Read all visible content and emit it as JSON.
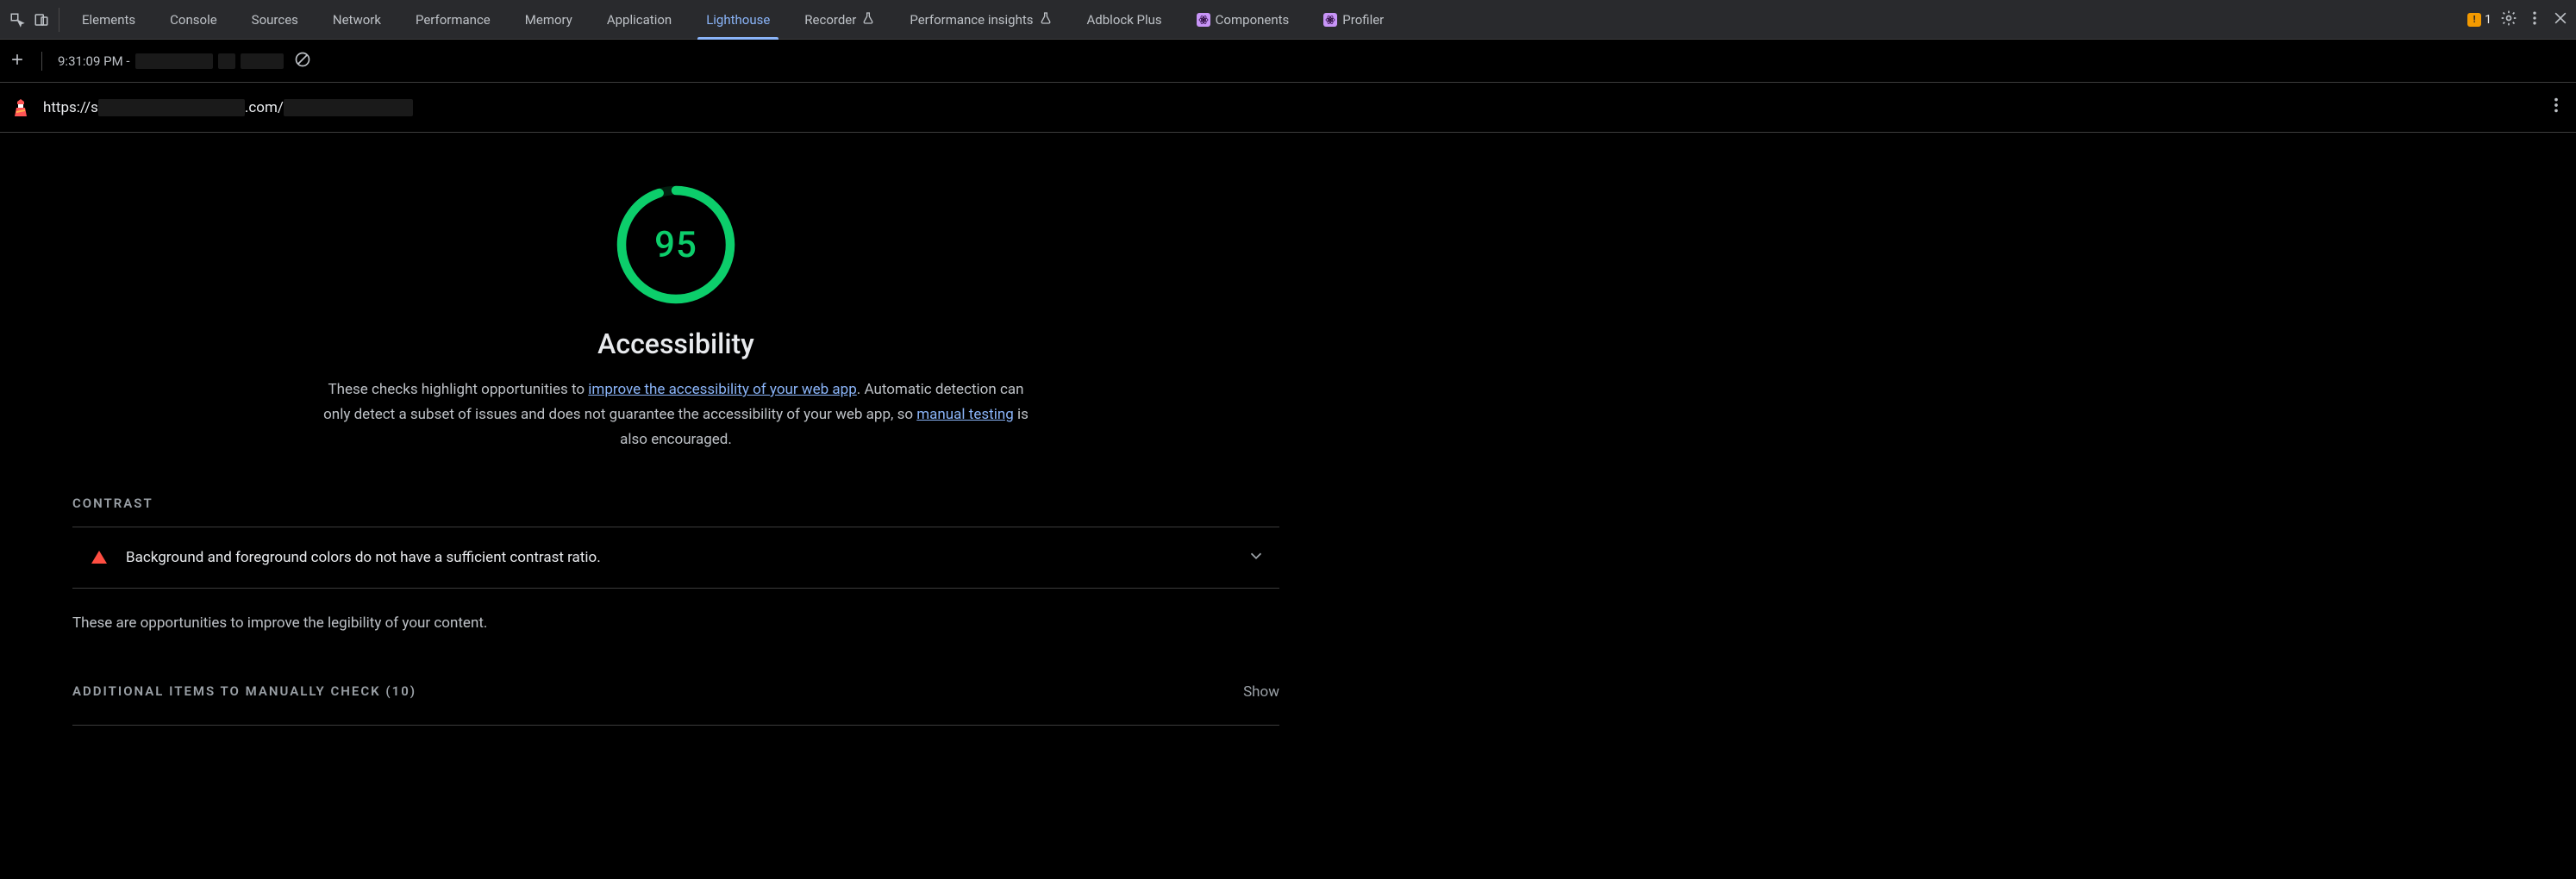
{
  "tabs": {
    "elements": "Elements",
    "console": "Console",
    "sources": "Sources",
    "network": "Network",
    "performance": "Performance",
    "memory": "Memory",
    "application": "Application",
    "lighthouse": "Lighthouse",
    "recorder": "Recorder",
    "perf_insights": "Performance insights",
    "adblock": "Adblock Plus",
    "components": "Components",
    "profiler": "Profiler"
  },
  "warnings_count": "1",
  "toolbar": {
    "timestamp_prefix": "9:31:09 PM -"
  },
  "url": {
    "prefix": "https://s",
    "mid": ".com/"
  },
  "gauge_score": "95",
  "category_title": "Accessibility",
  "description": {
    "pre": "These checks highlight opportunities to ",
    "link1": "improve the accessibility of your web app",
    "mid": ". Automatic detection can only detect a subset of issues and does not guarantee the accessibility of your web app, so ",
    "link2": "manual testing",
    "post": " is also encouraged."
  },
  "sections": {
    "contrast_title": "CONTRAST",
    "contrast_audit": "Background and foreground colors do not have a sufficient contrast ratio.",
    "contrast_note": "These are opportunities to improve the legibility of your content.",
    "manual_title": "ADDITIONAL ITEMS TO MANUALLY CHECK (10)",
    "show": "Show"
  }
}
